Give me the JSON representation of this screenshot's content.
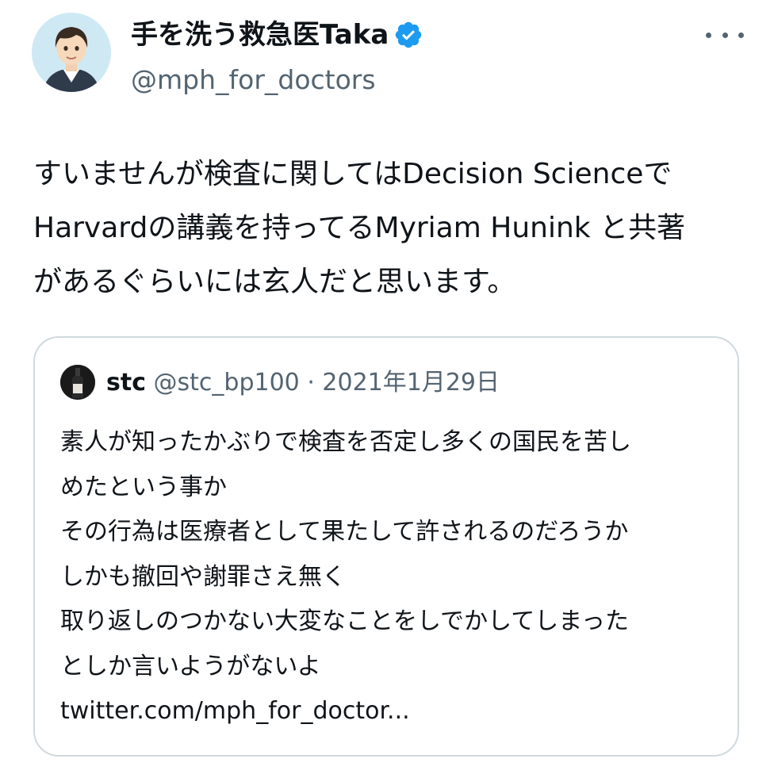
{
  "author": {
    "name": "手を洗う救急医Taka",
    "handle": "@mph_for_doctors",
    "verified_icon": "verified-badge-icon",
    "avatar_icon": "avatar"
  },
  "menu": {
    "more_icon": "more-options-icon"
  },
  "tweet": {
    "text": "すいませんが検査に関してはDecision Scienceで\nHarvardの講義を持ってるMyriam Hunink と共著\nがあるぐらいには玄人だと思います。"
  },
  "quoted": {
    "name": "stc",
    "handle": "@stc_bp100",
    "separator": "·",
    "date": "2021年1月29日",
    "text": "素人が知ったかぶりで検査を否定し多くの国民を苦し\nめたという事か\nその行為は医療者として果たして許されるのだろうか\nしかも撤回や謝罪さえ無く\n取り返しのつかない大変なことをしでかしてしまった\nとしか言いようがないよ\ntwitter.com/mph_for_doctor..."
  },
  "colors": {
    "text": "#0f1419",
    "secondary": "#536471",
    "verified": "#1d9bf0",
    "border": "#cfd9de"
  }
}
